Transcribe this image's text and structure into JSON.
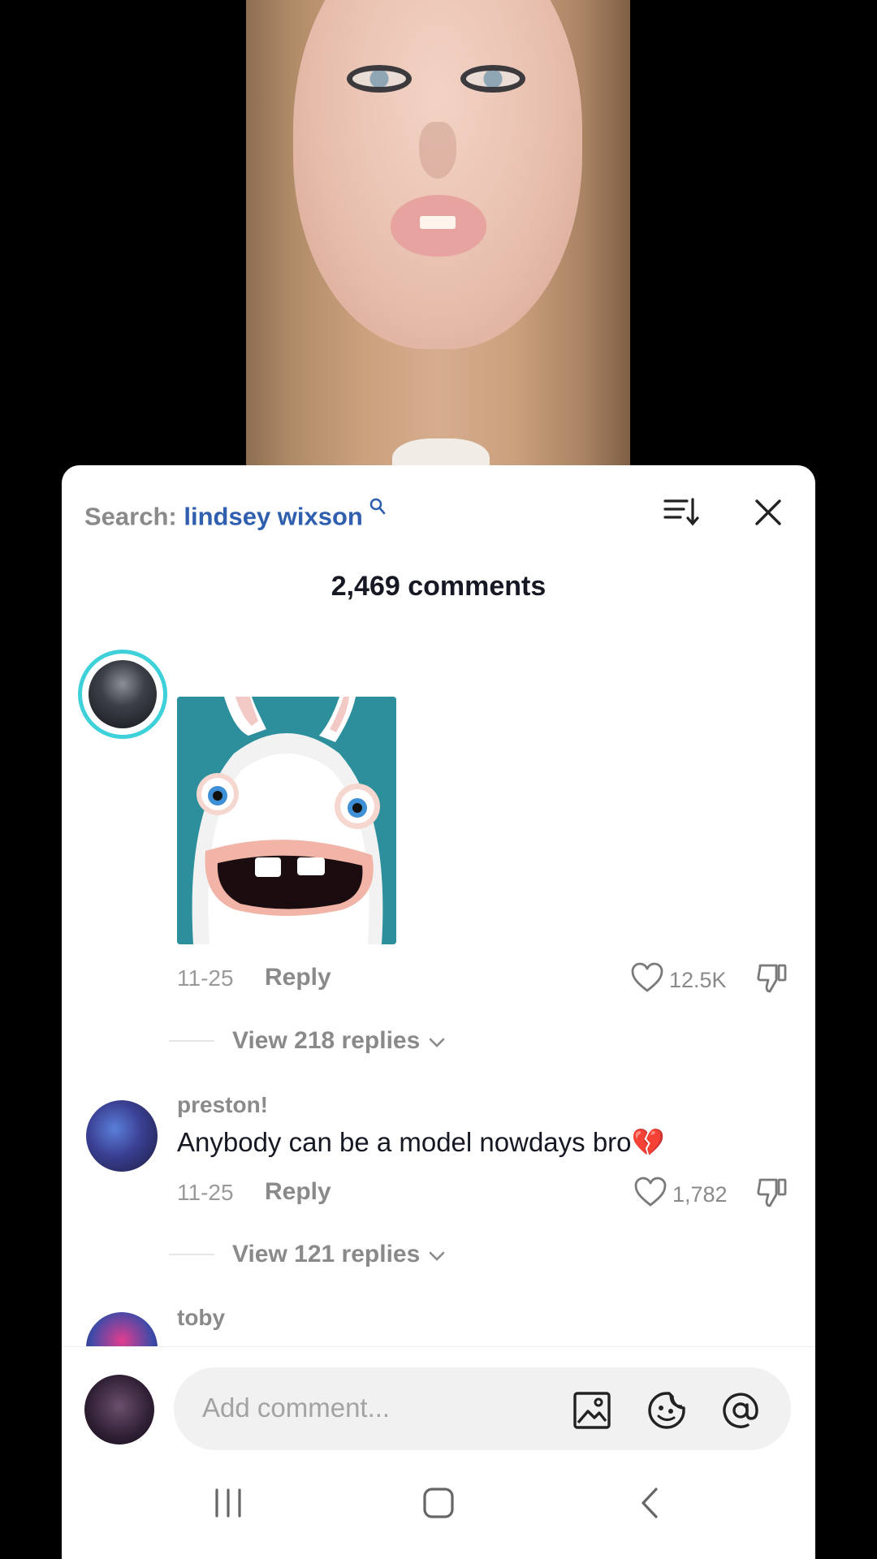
{
  "comments_panel": {
    "search_label": "Search:",
    "search_term": "lindsey wixson",
    "comment_count": "2,469 comments"
  },
  "comments": [
    {
      "username": "",
      "text": "",
      "has_sticker": true,
      "date": "11-25",
      "reply_label": "Reply",
      "likes": "12.5K",
      "view_replies": "View 218 replies"
    },
    {
      "username": "preston!",
      "text": "Anybody can be a model nowdays bro💔",
      "date": "11-25",
      "reply_label": "Reply",
      "likes": "1,782",
      "view_replies": "View 121 replies"
    },
    {
      "username": "toby"
    }
  ],
  "input": {
    "placeholder": "Add comment..."
  },
  "colors": {
    "accent_link": "#2f5fae",
    "muted_text": "#8a8a8a",
    "primary_text": "#161823"
  }
}
